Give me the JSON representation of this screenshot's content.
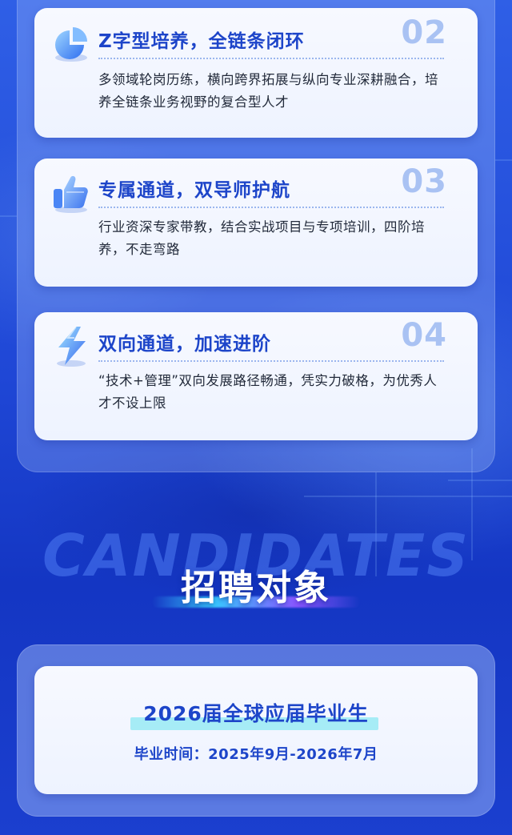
{
  "features": [
    {
      "icon": "pie-chart-icon",
      "title": "Z字型培养，全链条闭环",
      "number": "02",
      "description": "多领域轮岗历练，横向跨界拓展与纵向专业深耕融合，培养全链条业务视野的复合型人才"
    },
    {
      "icon": "thumbs-up-icon",
      "title": "专属通道，双导师护航",
      "number": "03",
      "description": "行业资深专家带教，结合实战项目与专项培训，四阶培养，不走弯路"
    },
    {
      "icon": "lightning-icon",
      "title": "双向通道，加速进阶",
      "number": "04",
      "description": "“技术+管理”双向发展路径畅通，凭实力破格，为优秀人才不设上限"
    }
  ],
  "section": {
    "background_word": "CANDIDATES",
    "title": "招聘对象"
  },
  "candidates": {
    "title": "2026届全球应届毕业生",
    "subtitle": "毕业时间：2025年9月-2026年7月"
  },
  "colors": {
    "accent": "#1d45c9",
    "number": "#a9c2f3",
    "background": "#1f47d6",
    "highlight": "#a6ecf6"
  }
}
